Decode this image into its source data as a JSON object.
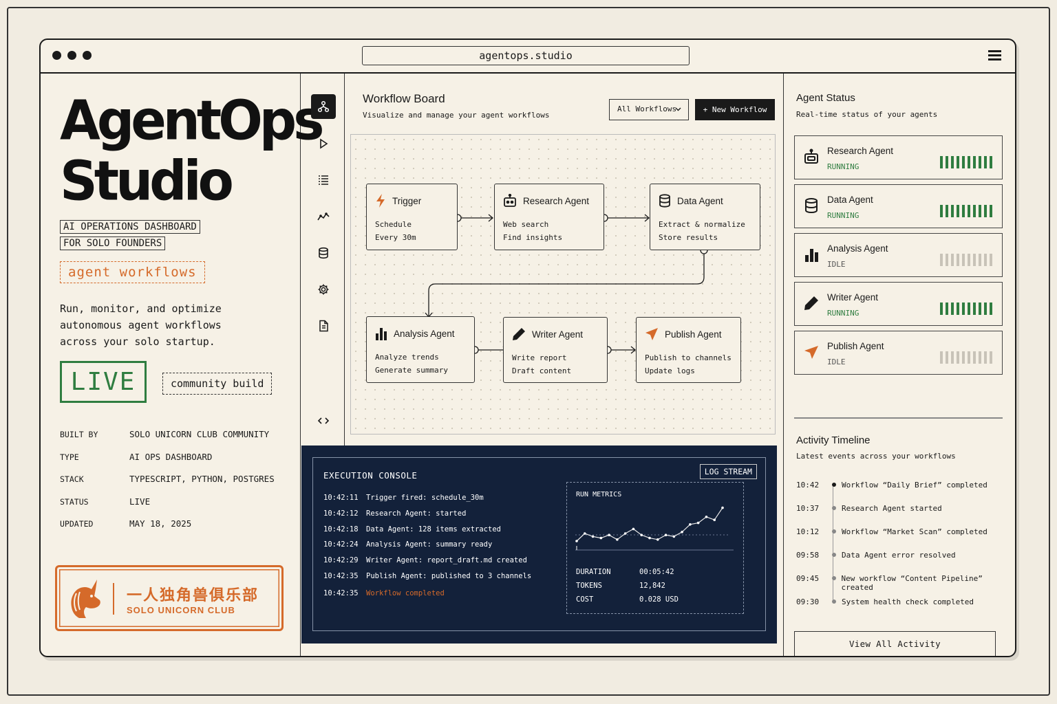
{
  "browser": {
    "url": "agentops.studio"
  },
  "brand": {
    "line1": "AgentOps",
    "line2": "Studio",
    "tagline1": "AI OPERATIONS DASHBOARD",
    "tagline2": "FOR SOLO FOUNDERS",
    "workflows_tag": "agent workflows",
    "desc1": "Run, monitor, and optimize",
    "desc2": "autonomous agent workflows",
    "desc3": "across your solo startup.",
    "live": "LIVE",
    "community": "community build"
  },
  "meta": [
    {
      "k": "BUILT BY",
      "v": "SOLO UNICORN CLUB COMMUNITY"
    },
    {
      "k": "TYPE",
      "v": "AI OPS DASHBOARD"
    },
    {
      "k": "STACK",
      "v": "TYPESCRIPT, PYTHON, POSTGRES"
    },
    {
      "k": "STATUS",
      "v": "LIVE"
    },
    {
      "k": "UPDATED",
      "v": "MAY 18, 2025"
    }
  ],
  "stamp": {
    "cn": "一人独角兽俱乐部",
    "en": "SOLO UNICORN CLUB"
  },
  "colors": {
    "accent": "#d56a2a",
    "live": "#2f7d40",
    "console_bg": "#13213a",
    "idle": "#c8c3b8"
  },
  "rail_icons": [
    "workflow-icon",
    "play-icon",
    "list-icon",
    "analytics-icon",
    "database-icon",
    "settings-icon",
    "document-icon",
    "collapse-icon"
  ],
  "board": {
    "title": "Workflow Board",
    "subtitle": "Visualize and manage your agent workflows",
    "filter": "All Workflows",
    "new_button": "+ New Workflow",
    "nodes": [
      {
        "title": "Trigger",
        "l1": "Schedule",
        "l2": "Every 30m",
        "icon": "bolt-icon"
      },
      {
        "title": "Research Agent",
        "l1": "Web search",
        "l2": "Find insights",
        "icon": "robot-icon"
      },
      {
        "title": "Data Agent",
        "l1": "Extract & normalize",
        "l2": "Store results",
        "icon": "database-icon"
      },
      {
        "title": "Analysis Agent",
        "l1": "Analyze trends",
        "l2": "Generate summary",
        "icon": "bar-chart-icon"
      },
      {
        "title": "Writer Agent",
        "l1": "Write report",
        "l2": "Draft content",
        "icon": "pencil-icon"
      },
      {
        "title": "Publish Agent",
        "l1": "Publish to channels",
        "l2": "Update logs",
        "icon": "send-icon"
      }
    ]
  },
  "console": {
    "title": "EXECUTION CONSOLE",
    "badge": "LOG STREAM",
    "logs": [
      {
        "t": "10:42:11",
        "m": "Trigger fired: schedule_30m"
      },
      {
        "t": "10:42:12",
        "m": "Research Agent: started"
      },
      {
        "t": "10:42:18",
        "m": "Data Agent: 128 items extracted"
      },
      {
        "t": "10:42:24",
        "m": "Analysis Agent: summary ready"
      },
      {
        "t": "10:42:29",
        "m": "Writer Agent: report_draft.md created"
      },
      {
        "t": "10:42:35",
        "m": "Publish Agent: published to 3 channels"
      },
      {
        "t": "10:42:35",
        "m": "Workflow completed"
      }
    ],
    "metrics": {
      "title": "RUN METRICS",
      "duration_label": "DURATION",
      "duration": "00:05:42",
      "tokens_label": "TOKENS",
      "tokens": "12,842",
      "cost_label": "COST",
      "cost": "0.028 USD"
    }
  },
  "chart_data": {
    "type": "line",
    "title": "RUN METRICS",
    "x": [
      0,
      1,
      2,
      3,
      4,
      5,
      6,
      7,
      8,
      9,
      10,
      11,
      12,
      13,
      14,
      15,
      16,
      17,
      18
    ],
    "values": [
      5,
      10,
      8,
      7,
      9,
      6,
      10,
      13,
      9,
      7,
      6,
      9,
      8,
      11,
      16,
      17,
      21,
      19,
      27
    ],
    "ylim": [
      0,
      30
    ]
  },
  "status": {
    "title": "Agent Status",
    "subtitle": "Real-time status of your agents",
    "agents": [
      {
        "name": "Research Agent",
        "state": "RUNNING",
        "icon": "robot-icon"
      },
      {
        "name": "Data Agent",
        "state": "RUNNING",
        "icon": "database-icon"
      },
      {
        "name": "Analysis Agent",
        "state": "IDLE",
        "icon": "bar-chart-icon"
      },
      {
        "name": "Writer Agent",
        "state": "RUNNING",
        "icon": "pencil-icon"
      },
      {
        "name": "Publish Agent",
        "state": "IDLE",
        "icon": "send-icon"
      }
    ]
  },
  "timeline": {
    "title": "Activity Timeline",
    "subtitle": "Latest events across your workflows",
    "events": [
      {
        "t": "10:42",
        "m": "Workflow “Daily Brief” completed"
      },
      {
        "t": "10:37",
        "m": "Research Agent started"
      },
      {
        "t": "10:12",
        "m": "Workflow “Market Scan” completed"
      },
      {
        "t": "09:58",
        "m": "Data Agent error resolved"
      },
      {
        "t": "09:45",
        "m": "New workflow “Content Pipeline” created"
      },
      {
        "t": "09:30",
        "m": "System health check completed"
      }
    ],
    "view_all": "View All Activity"
  }
}
